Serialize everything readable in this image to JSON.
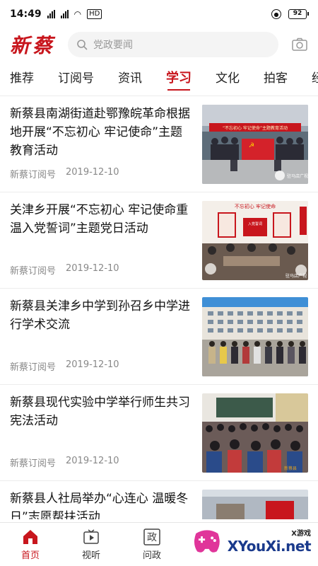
{
  "status_bar": {
    "time": "14:49",
    "network": "HD",
    "battery": "92"
  },
  "header": {
    "logo": "新蔡",
    "search_placeholder": "党政要闻"
  },
  "tabs": [
    {
      "label": "推荐",
      "active": false
    },
    {
      "label": "订阅号",
      "active": false
    },
    {
      "label": "资讯",
      "active": false
    },
    {
      "label": "学习",
      "active": true
    },
    {
      "label": "文化",
      "active": false
    },
    {
      "label": "拍客",
      "active": false
    },
    {
      "label": "经济",
      "active": false
    }
  ],
  "news": [
    {
      "title": "新蔡县南湖街道赴鄂豫皖革命根据地开展“不忘初心 牢记使命”主题教育活动",
      "source": "新蔡订阅号",
      "date": "2019-12-10"
    },
    {
      "title": "关津乡开展“不忘初心 牢记使命重温入党誓词”主题党日活动",
      "source": "新蔡订阅号",
      "date": "2019-12-10"
    },
    {
      "title": "新蔡县关津乡中学到孙召乡中学进行学术交流",
      "source": "新蔡订阅号",
      "date": "2019-12-10"
    },
    {
      "title": "新蔡县现代实验中学举行师生共习宪法活动",
      "source": "新蔡订阅号",
      "date": "2019-12-10"
    },
    {
      "title": "新蔡县人社局举办“心连心 温暖冬日”志愿帮扶活动",
      "source": "",
      "date": ""
    }
  ],
  "image_text": {
    "banner_1": "“不忘初心 牢记使命”主题教育活动",
    "banner_2": "不忘初心 牢记使命",
    "tag_2": "入党誓词",
    "wm_1": "驻马店广视",
    "wm_2": "驻马店广视",
    "wm_4": "新蔡县"
  },
  "bottom_nav": [
    {
      "label": "首页",
      "icon": "home-icon",
      "active": true
    },
    {
      "label": "视听",
      "icon": "tv-icon",
      "active": false
    },
    {
      "label": "问政",
      "icon": "wenzheng-icon",
      "active": false
    }
  ],
  "watermark": {
    "sub": "X游戏",
    "main": "XYouXi.net"
  },
  "colors": {
    "brand_red": "#c8161d",
    "watermark_blue": "#1a3a8c",
    "watermark_magenta": "#e0359a"
  }
}
